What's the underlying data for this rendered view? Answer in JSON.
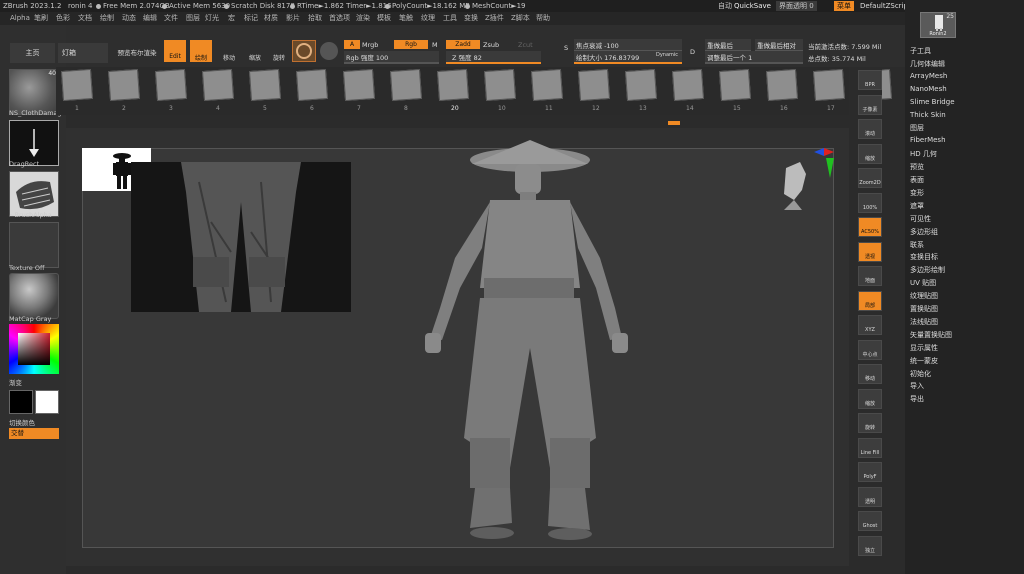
{
  "titlebar": {
    "app": "ZBrush 2023.1.2",
    "doc": "ronin 4",
    "free_mem": "Free Mem 2.074GB",
    "active_mem": "Active Mem 5630",
    "scratch": "Scratch Disk 8178",
    "rtime": "RTime►1.862 Timer►1.816",
    "polycount": "PolyCount►18.162 MP",
    "meshcount": "MeshCount►19",
    "autosave": "自动",
    "quicksave": "QuickSave",
    "transparency": "界面透明 0",
    "menu_btn": "菜单",
    "script": "DefaultZScript"
  },
  "menubar": [
    "Alpha",
    "笔刷",
    "色彩",
    "文档",
    "绘制",
    "动态",
    "编辑",
    "文件",
    "图层",
    "灯光",
    "宏",
    "标记",
    "材质",
    "影片",
    "拾取",
    "首选项",
    "渲染",
    "模板",
    "笔触",
    "纹理",
    "工具",
    "变换",
    "Z插件",
    "Z脚本",
    "帮助"
  ],
  "left": {
    "material_count": "40",
    "material_name": "NS_ClothDamag",
    "stroke_name": "DragRect",
    "alpha_name": "~BrushAlpha",
    "texture_name": "Texture Off",
    "matcap_name": "MatCap Gray",
    "gradient_label": "渐变",
    "switch_label": "切换颜色",
    "alternate_label": "交替"
  },
  "shelf": {
    "home": "主页",
    "lightbox": "灯箱",
    "preview_render": "预览布尔渲染",
    "edit": "Edit",
    "draw": "绘制",
    "move": "移动",
    "scale": "缩放",
    "rotate": "旋转",
    "a_label": "A",
    "mrgb": "Mrgb",
    "rgb": "Rgb",
    "m": "M",
    "zadd": "Zadd",
    "zsub": "Zsub",
    "zcut": "Zcut",
    "rgb_intensity": "Rgb 强度 100",
    "z_intensity": "Z 强度 82",
    "focal_shift": "焦点衰减 -100",
    "draw_size": "绘制大小 176.83799",
    "dynamic": "Dynamic",
    "s_label": "S",
    "d_label": "D",
    "replay_last": "重做最后",
    "replay_last_rel": "重做最后相对",
    "adjust_last": "调整最后一个 1",
    "active_points": "当前激活点数: 7.599 Mil",
    "total_points": "总点数: 35.774 Mil"
  },
  "brush_numbers": [
    "1",
    "2",
    "3",
    "4",
    "5",
    "6",
    "7",
    "8",
    "20",
    "10",
    "11",
    "12",
    "13",
    "14",
    "15",
    "16",
    "17",
    "18"
  ],
  "right_panel": {
    "tool_count": "25",
    "tool_name": "Ronin2",
    "items": [
      "子工具",
      "几何体编辑",
      "ArrayMesh",
      "NanoMesh",
      "Slime Bridge",
      "Thick Skin",
      "图层",
      "FiberMesh",
      "HD 几何",
      "预览",
      "表面",
      "变形",
      "遮罩",
      "可见性",
      "多边形组",
      "联系",
      "变换目标",
      "多边形绘制",
      "UV 贴图",
      "纹理贴图",
      "置换贴图",
      "法线贴图",
      "矢量置换贴图",
      "显示属性",
      "统一蒙皮",
      "初始化",
      "导入",
      "导出"
    ]
  },
  "vtool": [
    "BPR",
    "子像素",
    "滚动",
    "缩放",
    "Zoom2D",
    "100%",
    "AC50%",
    "透视",
    "地面",
    "局部",
    "XYZ",
    "中心点",
    "移动",
    "缩放",
    "旋转",
    "Line Fill",
    "PolyF",
    "透明",
    "Ghost",
    "独立"
  ]
}
